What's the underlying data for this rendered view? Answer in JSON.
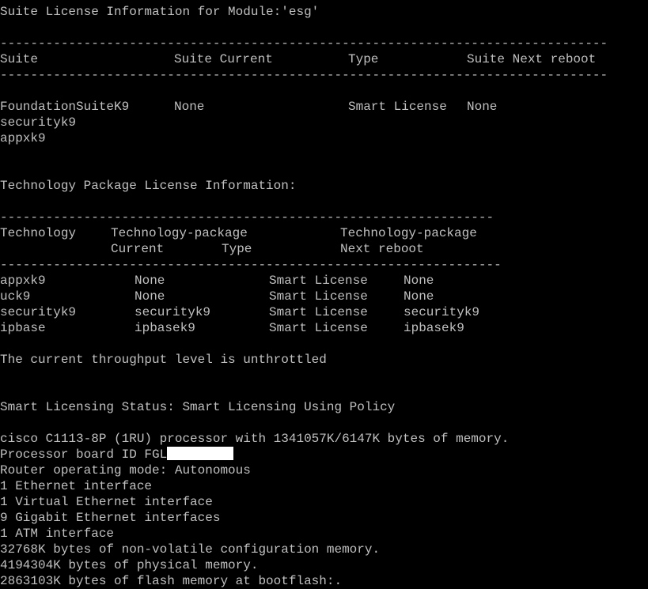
{
  "colors": {
    "background": "#000000",
    "text": "#c0c0c0",
    "redaction": "#ffffff"
  },
  "suite_section": {
    "heading": "Suite License Information for Module:'esg'",
    "rule_top": "--------------------------------------------------------------------------------",
    "headers": [
      "Suite",
      "Suite Current",
      "Type",
      "Suite Next reboot"
    ],
    "rule_bottom": "--------------------------------------------------------------------------------",
    "row": {
      "suite": "FoundationSuiteK9",
      "current": "None",
      "type": "Smart License",
      "next": "None"
    },
    "sub_items": [
      "securityk9",
      "appxk9"
    ]
  },
  "tech_section": {
    "heading": "Technology Package License Information:",
    "rule_top": "-----------------------------------------------------------------",
    "header1": [
      "Technology",
      "Technology-package",
      "Technology-package"
    ],
    "header2": [
      "Current",
      "Type",
      "Next reboot"
    ],
    "rule_bottom": "------------------------------------------------------------------",
    "rows": [
      {
        "tech": "appxk9",
        "current": "None",
        "type": "Smart License",
        "next": "None"
      },
      {
        "tech": "uck9",
        "current": "None",
        "type": "Smart License",
        "next": "None"
      },
      {
        "tech": "securityk9",
        "current": "securityk9",
        "type": "Smart License",
        "next": "securityk9"
      },
      {
        "tech": "ipbase",
        "current": "ipbasek9",
        "type": "Smart License",
        "next": "ipbasek9"
      }
    ]
  },
  "throughput": "The current throughput level is unthrottled",
  "smart_status": "Smart Licensing Status: Smart Licensing Using Policy",
  "hardware": {
    "processor": "cisco C1113-8P (1RU) processor with 1341057K/6147K bytes of memory.",
    "board_id_prefix": "Processor board ID FGL",
    "mode": "Router operating mode: Autonomous",
    "interfaces": [
      "1 Ethernet interface",
      "1 Virtual Ethernet interface",
      "9 Gigabit Ethernet interfaces",
      "1 ATM interface"
    ],
    "memory": [
      "32768K bytes of non-volatile configuration memory.",
      "4194304K bytes of physical memory.",
      "2863103K bytes of flash memory at bootflash:."
    ]
  }
}
